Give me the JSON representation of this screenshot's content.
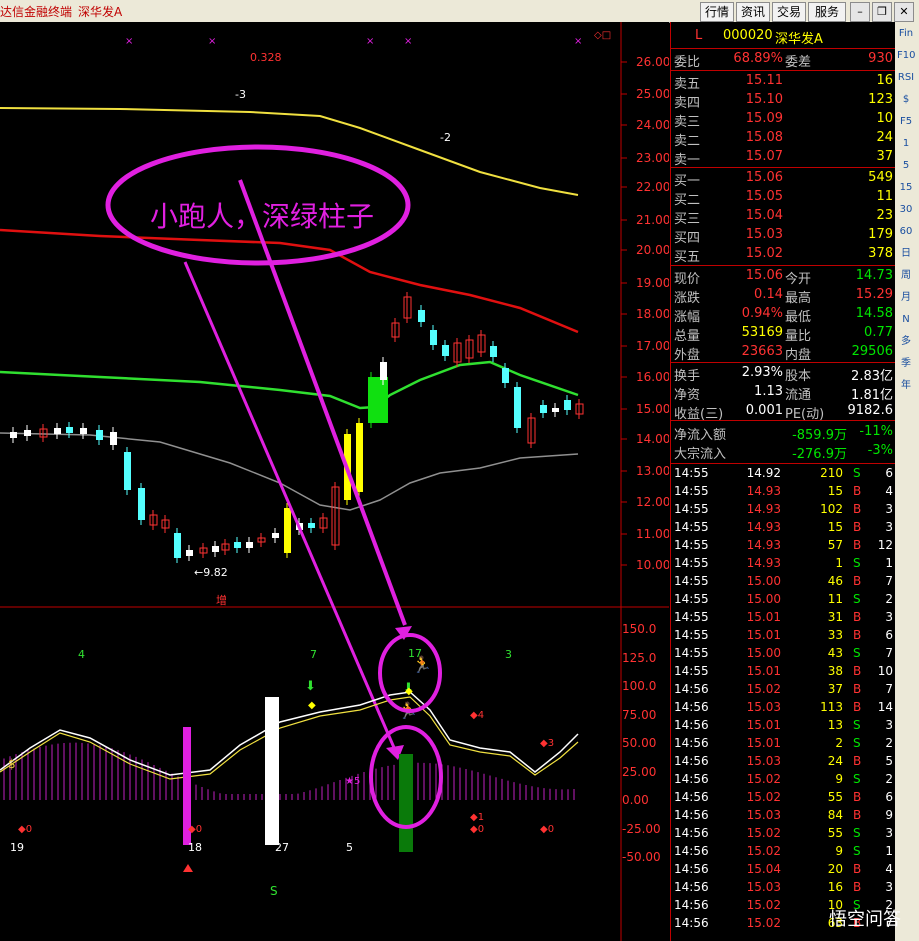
{
  "window": {
    "title": "达信金融终端",
    "stock_title": "深华发A",
    "buttons": [
      "行情",
      "资讯",
      "交易",
      "服务"
    ]
  },
  "colors": {
    "bg": "#000000",
    "up": "#ff3232",
    "down": "#54ffff",
    "ma_yellow": "#f0e040",
    "ma_red": "#e01010",
    "ma_green": "#30e030",
    "ma_gray": "#909090",
    "annotation": "#e020e0"
  },
  "price_chart": {
    "high_label": "0.328",
    "low_label": "←9.82",
    "y_ticks": [
      "26.00",
      "25.00",
      "24.00",
      "23.00",
      "22.00",
      "21.00",
      "20.00",
      "19.00",
      "18.00",
      "17.00",
      "16.00",
      "15.00",
      "14.00",
      "13.00",
      "12.00",
      "11.00",
      "10.00"
    ],
    "wave_labels": [
      "-3",
      "-2"
    ],
    "bottom_label": "增",
    "annotation": "小跑人，深绿柱子"
  },
  "indicator": {
    "y_ticks": [
      "150.0",
      "125.0",
      "100.0",
      "75.00",
      "50.00",
      "25.00",
      "0.00",
      "-25.00",
      "-50.00"
    ],
    "top_numbers": [
      "4",
      "7",
      "17",
      "3"
    ],
    "bottom_numbers": [
      "19",
      "18",
      "27",
      "5"
    ],
    "markers": [
      "0",
      "0",
      "0",
      "1",
      "0",
      "4",
      "3",
      "5"
    ],
    "s_label": "S"
  },
  "quote": {
    "code_prefix": "L",
    "code": "000020",
    "name": "深华发A",
    "weibi_label": "委比",
    "weibi": "68.89%",
    "weicha_label": "委差",
    "weicha": "930",
    "asks": [
      {
        "label": "卖五",
        "price": "15.11",
        "vol": "16"
      },
      {
        "label": "卖四",
        "price": "15.10",
        "vol": "123"
      },
      {
        "label": "卖三",
        "price": "15.09",
        "vol": "10"
      },
      {
        "label": "卖二",
        "price": "15.08",
        "vol": "24"
      },
      {
        "label": "卖一",
        "price": "15.07",
        "vol": "37"
      }
    ],
    "bids": [
      {
        "label": "买一",
        "price": "15.06",
        "vol": "549"
      },
      {
        "label": "买二",
        "price": "15.05",
        "vol": "11"
      },
      {
        "label": "买三",
        "price": "15.04",
        "vol": "23"
      },
      {
        "label": "买四",
        "price": "15.03",
        "vol": "179"
      },
      {
        "label": "买五",
        "price": "15.02",
        "vol": "378"
      }
    ],
    "stats": [
      {
        "l1": "现价",
        "v1": "15.06",
        "c1": "red",
        "l2": "今开",
        "v2": "14.73",
        "c2": "grn"
      },
      {
        "l1": "涨跌",
        "v1": "0.14",
        "c1": "red",
        "l2": "最高",
        "v2": "15.29",
        "c2": "red"
      },
      {
        "l1": "涨幅",
        "v1": "0.94%",
        "c1": "red",
        "l2": "最低",
        "v2": "14.58",
        "c2": "grn"
      },
      {
        "l1": "总量",
        "v1": "53169",
        "c1": "yel",
        "l2": "量比",
        "v2": "0.77",
        "c2": "grn"
      },
      {
        "l1": "外盘",
        "v1": "23663",
        "c1": "red",
        "l2": "内盘",
        "v2": "29506",
        "c2": "grn"
      }
    ],
    "stats2": [
      {
        "l1": "换手",
        "v1": "2.93%",
        "l2": "股本",
        "v2": "2.83亿"
      },
      {
        "l1": "净资",
        "v1": "1.13",
        "l2": "流通",
        "v2": "1.81亿"
      },
      {
        "l1": "收益(三)",
        "v1": "0.001",
        "l2": "PE(动)",
        "v2": "9182.6"
      }
    ],
    "flows": [
      {
        "label": "净流入额",
        "value": "-859.9万",
        "pct": "-11%"
      },
      {
        "label": "大宗流入",
        "value": "-276.9万",
        "pct": "-3%"
      }
    ],
    "ticks": [
      {
        "time": "14:55",
        "price": "14.92",
        "pc": "wht",
        "vol": "210",
        "bs": "S",
        "n": "6"
      },
      {
        "time": "14:55",
        "price": "14.93",
        "pc": "red",
        "vol": "15",
        "bs": "B",
        "n": "4"
      },
      {
        "time": "14:55",
        "price": "14.93",
        "pc": "red",
        "vol": "102",
        "bs": "B",
        "n": "3"
      },
      {
        "time": "14:55",
        "price": "14.93",
        "pc": "red",
        "vol": "15",
        "bs": "B",
        "n": "3"
      },
      {
        "time": "14:55",
        "price": "14.93",
        "pc": "red",
        "vol": "57",
        "bs": "B",
        "n": "12"
      },
      {
        "time": "14:55",
        "price": "14.93",
        "pc": "red",
        "vol": "1",
        "bs": "S",
        "n": "1"
      },
      {
        "time": "14:55",
        "price": "15.00",
        "pc": "red",
        "vol": "46",
        "bs": "B",
        "n": "7"
      },
      {
        "time": "14:55",
        "price": "15.00",
        "pc": "red",
        "vol": "11",
        "bs": "S",
        "n": "2"
      },
      {
        "time": "14:55",
        "price": "15.01",
        "pc": "red",
        "vol": "31",
        "bs": "B",
        "n": "3"
      },
      {
        "time": "14:55",
        "price": "15.01",
        "pc": "red",
        "vol": "33",
        "bs": "B",
        "n": "6"
      },
      {
        "time": "14:55",
        "price": "15.00",
        "pc": "red",
        "vol": "43",
        "bs": "S",
        "n": "7"
      },
      {
        "time": "14:55",
        "price": "15.01",
        "pc": "red",
        "vol": "38",
        "bs": "B",
        "n": "10"
      },
      {
        "time": "14:56",
        "price": "15.02",
        "pc": "red",
        "vol": "37",
        "bs": "B",
        "n": "7"
      },
      {
        "time": "14:56",
        "price": "15.03",
        "pc": "red",
        "vol": "113",
        "bs": "B",
        "n": "14"
      },
      {
        "time": "14:56",
        "price": "15.01",
        "pc": "red",
        "vol": "13",
        "bs": "S",
        "n": "3"
      },
      {
        "time": "14:56",
        "price": "15.01",
        "pc": "red",
        "vol": "2",
        "bs": "S",
        "n": "2"
      },
      {
        "time": "14:56",
        "price": "15.03",
        "pc": "red",
        "vol": "24",
        "bs": "B",
        "n": "5"
      },
      {
        "time": "14:56",
        "price": "15.02",
        "pc": "red",
        "vol": "9",
        "bs": "S",
        "n": "2"
      },
      {
        "time": "14:56",
        "price": "15.02",
        "pc": "red",
        "vol": "55",
        "bs": "B",
        "n": "6"
      },
      {
        "time": "14:56",
        "price": "15.03",
        "pc": "red",
        "vol": "84",
        "bs": "B",
        "n": "9"
      },
      {
        "time": "14:56",
        "price": "15.02",
        "pc": "red",
        "vol": "55",
        "bs": "S",
        "n": "3"
      },
      {
        "time": "14:56",
        "price": "15.02",
        "pc": "red",
        "vol": "9",
        "bs": "S",
        "n": "1"
      },
      {
        "time": "14:56",
        "price": "15.04",
        "pc": "red",
        "vol": "20",
        "bs": "B",
        "n": "4"
      },
      {
        "time": "14:56",
        "price": "15.03",
        "pc": "red",
        "vol": "16",
        "bs": "B",
        "n": "3"
      },
      {
        "time": "14:56",
        "price": "15.02",
        "pc": "red",
        "vol": "10",
        "bs": "S",
        "n": "2"
      },
      {
        "time": "14:56",
        "price": "15.02",
        "pc": "red",
        "vol": "63",
        "bs": "B",
        "n": "7"
      }
    ]
  },
  "toolbar": {
    "items": [
      "Fin",
      "F10",
      "RSI",
      "$",
      "F5",
      "1",
      "5",
      "15",
      "30",
      "60",
      "日",
      "周",
      "月",
      "N",
      "多",
      "季",
      "年"
    ]
  },
  "watermark": "悟空问答"
}
